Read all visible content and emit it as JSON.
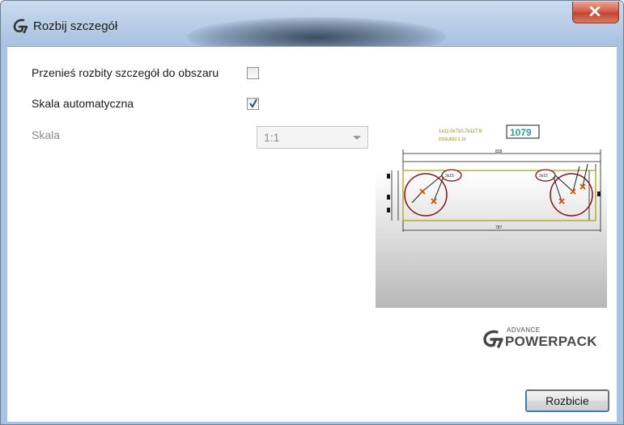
{
  "window": {
    "title": "Rozbij szczegół"
  },
  "options": {
    "move_label": "Przenieś rozbity szczegół do obszaru",
    "move_checked": false,
    "auto_scale_label": "Skala automatyczna",
    "auto_scale_checked": true,
    "scale_label": "Skala",
    "scale_value": "1:1",
    "scale_enabled": false
  },
  "preview": {
    "note_text": "1x11.0x710.7x117.9",
    "note_text2": "DSSU602-1.10",
    "boxed_number": "1079",
    "dim_top": "828",
    "dim_bottom": "787",
    "label_left": "3x15",
    "label_right": "3x15"
  },
  "branding": {
    "small": "ADVANCE",
    "large": "POWERPACK"
  },
  "actions": {
    "explode_label": "Rozbicie"
  }
}
